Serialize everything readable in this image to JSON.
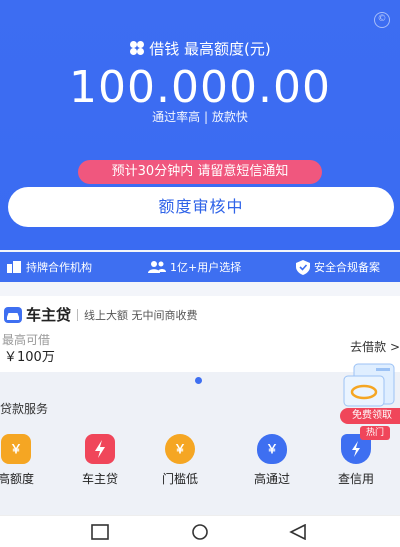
{
  "hero": {
    "title": "借钱 最高额度(元)",
    "amount": "100.000.00",
    "subtitle": "通过率高 | 放款快",
    "notice": "预计30分钟内 请留意短信通知",
    "main_button": "额度审核中"
  },
  "features": [
    {
      "icon": "building-icon",
      "label": "持牌合作机构"
    },
    {
      "icon": "users-icon",
      "label": "1亿+用户选择"
    },
    {
      "icon": "shield-icon",
      "label": "安全合规备案"
    }
  ],
  "loan_card": {
    "title": "车主贷",
    "description": "线上大额 无中间商收费",
    "limit_label": "最高可借",
    "limit_value": "￥100万",
    "action": "去借款 >"
  },
  "services_section": {
    "title": "贷款服务",
    "items": [
      {
        "label": "高额度",
        "icon": "yen-icon",
        "color": "#f5a623"
      },
      {
        "label": "车主贷",
        "icon": "lightning-icon",
        "color": "#f0465a"
      },
      {
        "label": "门槛低",
        "icon": "yen-icon",
        "color": "#f5a623"
      },
      {
        "label": "高通过",
        "icon": "money-bag-icon",
        "color": "#3e6ff1"
      },
      {
        "label": "查信用",
        "icon": "shield-lightning-icon",
        "color": "#3e6ff1"
      }
    ]
  },
  "promo": {
    "badge_top": "免费领取",
    "badge_bottom": "热门"
  },
  "colors": {
    "primary": "#3e6ff1",
    "notice": "#f0577e",
    "accent_orange": "#f5a623",
    "accent_red": "#f0465a"
  }
}
